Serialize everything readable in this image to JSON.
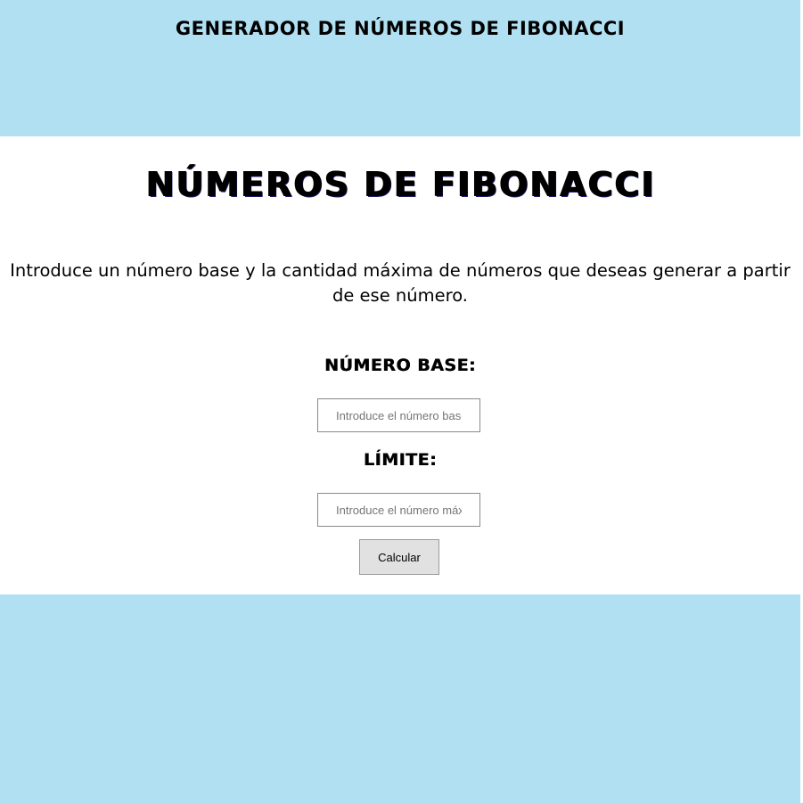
{
  "header": {
    "title": "GENERADOR DE NÚMEROS DE FIBONACCI"
  },
  "main": {
    "title": "NÚMEROS DE FIBONACCI",
    "intro": "Introduce un número base y la cantidad máxima de números que deseas generar a partir de ese número.",
    "fields": {
      "base": {
        "label": "NÚMERO BASE:",
        "placeholder": "Introduce el número base",
        "value": ""
      },
      "limit": {
        "label": "LÍMITE:",
        "placeholder": "Introduce el número máximo",
        "value": ""
      }
    },
    "calculate_label": "Calcular"
  },
  "colors": {
    "background": "#b0e0f2",
    "panel": "#ffffff",
    "button": "#e1e1e1"
  }
}
